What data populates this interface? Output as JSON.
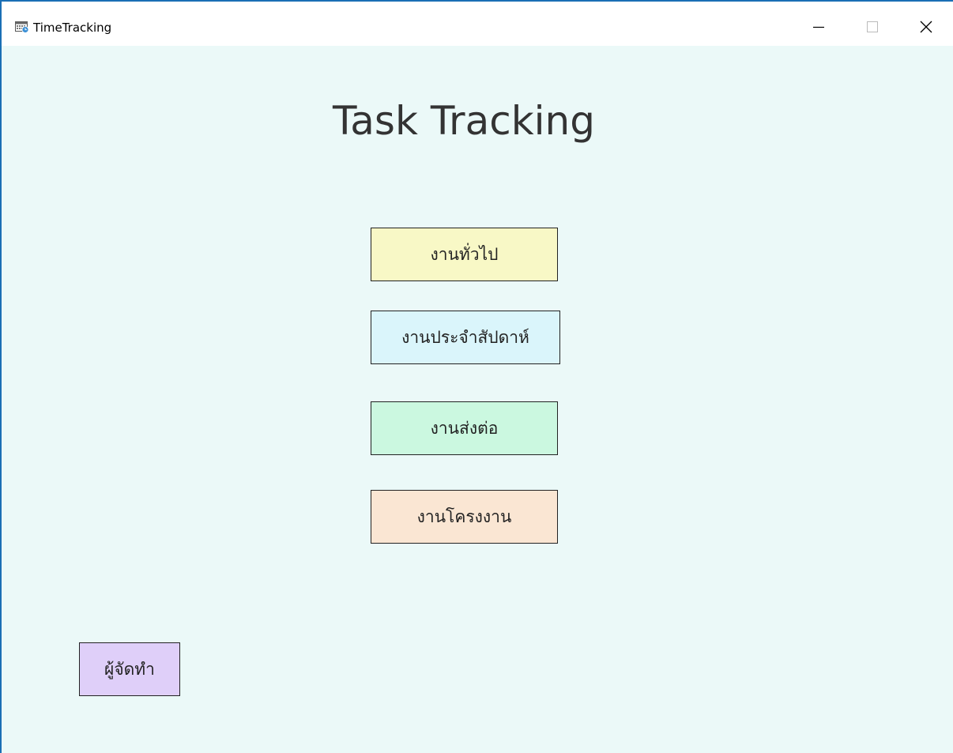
{
  "window": {
    "title": "TimeTracking",
    "icon": "calendar-clock-icon",
    "controls": {
      "minimize": "minimize-icon",
      "maximize": "maximize-icon",
      "close": "close-icon"
    }
  },
  "main": {
    "title": "Task Tracking",
    "buttons": {
      "general": "งานทั่วไป",
      "weekly": "งานประจำสัปดาห์",
      "forward": "งานส่งต่อ",
      "project": "งานโครงงาน",
      "author": "ผู้จัดทำ"
    }
  },
  "colors": {
    "background": "#ebf9f8",
    "window_border": "#1a6fb5",
    "general_button": "#f8f8c6",
    "weekly_button": "#daf5fb",
    "forward_button": "#cbf8e0",
    "project_button": "#fae6d3",
    "author_button": "#dfcff9"
  }
}
